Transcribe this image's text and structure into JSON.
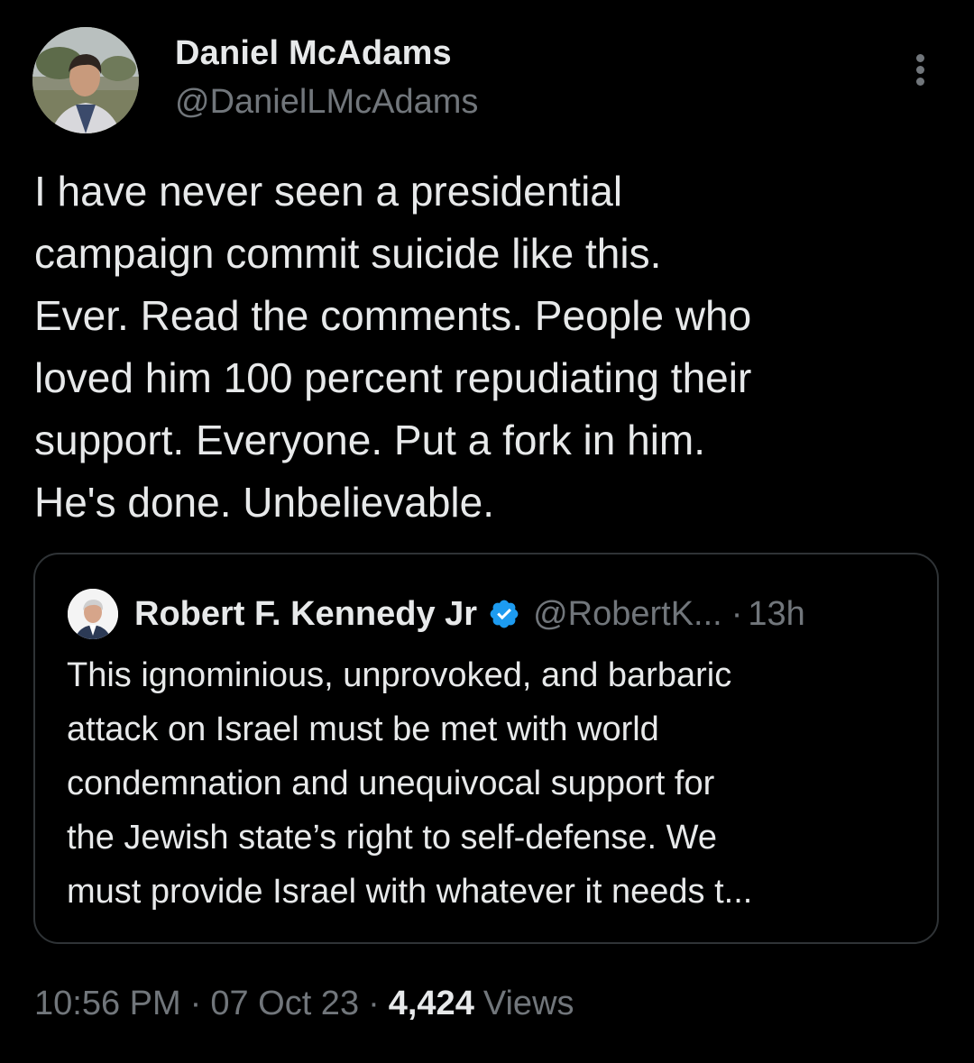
{
  "tweet": {
    "author": {
      "name": "Daniel McAdams",
      "handle": "@DanielLMcAdams"
    },
    "text": "I have never seen a presidential\ncampaign commit suicide like this.\nEver. Read the comments. People who\nloved him 100 percent repudiating their\nsupport. Everyone. Put a fork in him.\nHe's done. Unbelievable.",
    "quoted": {
      "name": "Robert F. Kennedy Jr",
      "handle": "@RobertK...",
      "dot": "·",
      "time": "13h",
      "text": "This ignominious, unprovoked, and barbaric\nattack on Israel must be met with world\ncondemnation and unequivocal support for\nthe Jewish state’s right to self-defense. We\nmust provide Israel with whatever it needs t..."
    },
    "meta": {
      "time": "10:56 PM",
      "sep1": "·",
      "date": "07 Oct 23",
      "sep2": "·",
      "views_count": "4,424",
      "views_label": "Views"
    }
  },
  "icons": {
    "more": "more-vertical-icon",
    "verified": "verified-badge-icon"
  },
  "colors": {
    "background": "#000000",
    "text_primary": "#e7e9ea",
    "text_secondary": "#71767b",
    "border": "#2f3336",
    "verified_blue": "#1d9bf0"
  }
}
